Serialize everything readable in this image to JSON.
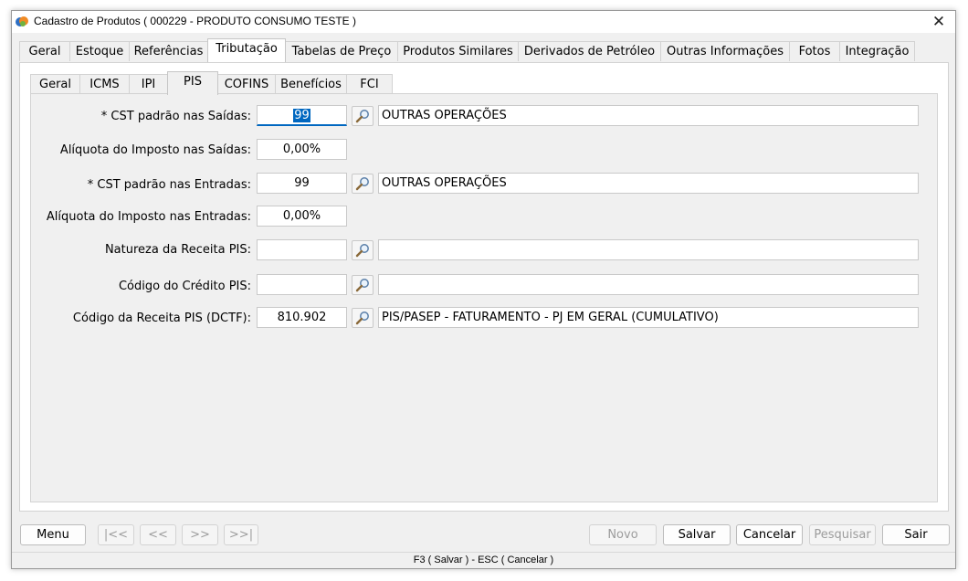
{
  "window": {
    "title": "Cadastro de Produtos ( 000229 - PRODUTO CONSUMO TESTE )",
    "close_glyph": "✕"
  },
  "main_tabs": [
    {
      "label": "Geral",
      "active": false
    },
    {
      "label": "Estoque",
      "active": false
    },
    {
      "label": "Referências",
      "active": false
    },
    {
      "label": "Tributação",
      "active": true
    },
    {
      "label": "Tabelas de Preço",
      "active": false
    },
    {
      "label": "Produtos Similares",
      "active": false
    },
    {
      "label": "Derivados de Petróleo",
      "active": false
    },
    {
      "label": "Outras Informações",
      "active": false
    },
    {
      "label": "Fotos",
      "active": false
    },
    {
      "label": "Integração",
      "active": false
    }
  ],
  "sub_tabs": [
    {
      "label": "Geral",
      "active": false
    },
    {
      "label": "ICMS",
      "active": false
    },
    {
      "label": "IPI",
      "active": false
    },
    {
      "label": "PIS",
      "active": true
    },
    {
      "label": "COFINS",
      "active": false
    },
    {
      "label": "Benefícios",
      "active": false
    },
    {
      "label": "FCI",
      "active": false
    }
  ],
  "form": {
    "cst_saidas": {
      "label": "* CST padrão nas Saídas:",
      "value": "99",
      "desc": "OUTRAS OPERAÇÕES"
    },
    "aliq_saidas": {
      "label": "Alíquota do Imposto nas Saídas:",
      "value": "0,00%"
    },
    "cst_entradas": {
      "label": "* CST padrão nas Entradas:",
      "value": "99",
      "desc": "OUTRAS OPERAÇÕES"
    },
    "aliq_entradas": {
      "label": "Alíquota do Imposto nas Entradas:",
      "value": "0,00%"
    },
    "natureza": {
      "label": "Natureza da Receita PIS:",
      "value": "",
      "desc": ""
    },
    "credito": {
      "label": "Código do Crédito PIS:",
      "value": "",
      "desc": ""
    },
    "receita_dctf": {
      "label": "Código da Receita PIS (DCTF):",
      "value": "810.902",
      "desc": "PIS/PASEP - FATURAMENTO - PJ EM GERAL (CUMULATIVO)"
    }
  },
  "footer": {
    "menu": "Menu",
    "first": "|<<",
    "prev": "<<",
    "next": ">>",
    "last": ">>|",
    "novo": "Novo",
    "salvar": "Salvar",
    "cancelar": "Cancelar",
    "pesquisar": "Pesquisar",
    "sair": "Sair"
  },
  "status": "F3 ( Salvar )  -  ESC ( Cancelar )",
  "colors": {
    "accent": "#0067c0",
    "icon_orange": "#f08a24",
    "icon_blue": "#2d6fc4"
  }
}
